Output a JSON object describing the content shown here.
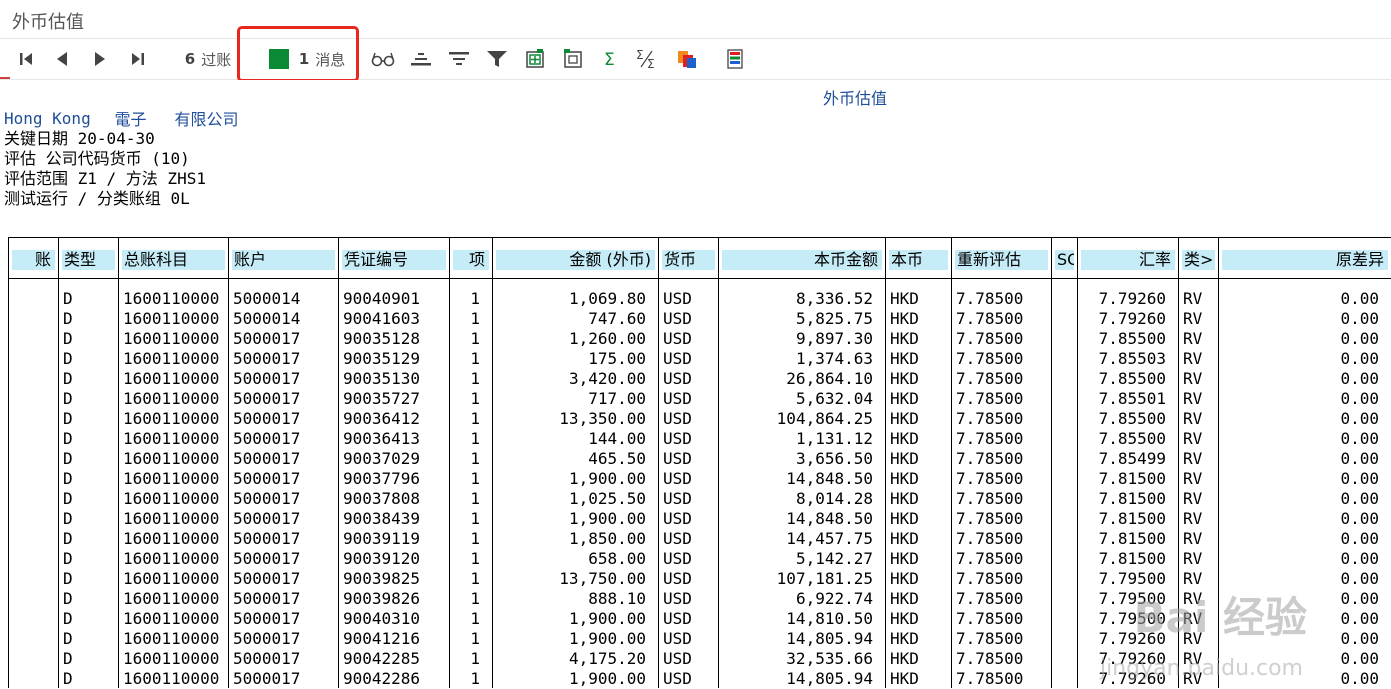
{
  "window": {
    "title": "外币估值"
  },
  "toolbar": {
    "post_count": "6",
    "post_label": "过账",
    "message_count": "1",
    "message_label": "消息",
    "accent_red": "#e8281e",
    "message_color": "#0b8a36",
    "icons": [
      "first-page-icon",
      "previous-page-icon",
      "next-page-icon",
      "last-page-icon",
      "glasses-icon",
      "sort-ascending-icon",
      "sort-descending-icon",
      "filter-icon",
      "export-icon",
      "import-icon",
      "sum-icon",
      "subtotal-icon",
      "layout-icon",
      "select-layout-icon"
    ]
  },
  "report": {
    "company_suffix_1": "電子",
    "company_suffix_2": "有限公司",
    "report_title": "外币估值",
    "location": "Hong Kong",
    "key_date_label": "关键日期",
    "key_date": "20-04-30",
    "line_valuation": "评估 公司代码货币 (10)",
    "line_area": "评估范围 Z1 / 方法 ZHS1",
    "line_test": "测试运行 / 分类账组 0L"
  },
  "table": {
    "columns": [
      "账",
      "类型",
      "总账科目",
      "账户",
      "凭证编号",
      "项",
      "金额 (外币)",
      "货币",
      "本币金额",
      "本币",
      "重新评估",
      "SG",
      "汇率",
      "类>",
      "原差异"
    ],
    "rows": [
      [
        "",
        "D",
        "1600110000",
        "5000014",
        "90040901",
        "1",
        "1,069.80",
        "USD",
        "8,336.52",
        "HKD",
        "7.78500",
        "",
        "7.79260",
        "RV",
        "0.00"
      ],
      [
        "",
        "D",
        "1600110000",
        "5000014",
        "90041603",
        "1",
        "747.60",
        "USD",
        "5,825.75",
        "HKD",
        "7.78500",
        "",
        "7.79260",
        "RV",
        "0.00"
      ],
      [
        "",
        "D",
        "1600110000",
        "5000017",
        "90035128",
        "1",
        "1,260.00",
        "USD",
        "9,897.30",
        "HKD",
        "7.78500",
        "",
        "7.85500",
        "RV",
        "0.00"
      ],
      [
        "",
        "D",
        "1600110000",
        "5000017",
        "90035129",
        "1",
        "175.00",
        "USD",
        "1,374.63",
        "HKD",
        "7.78500",
        "",
        "7.85503",
        "RV",
        "0.00"
      ],
      [
        "",
        "D",
        "1600110000",
        "5000017",
        "90035130",
        "1",
        "3,420.00",
        "USD",
        "26,864.10",
        "HKD",
        "7.78500",
        "",
        "7.85500",
        "RV",
        "0.00"
      ],
      [
        "",
        "D",
        "1600110000",
        "5000017",
        "90035727",
        "1",
        "717.00",
        "USD",
        "5,632.04",
        "HKD",
        "7.78500",
        "",
        "7.85501",
        "RV",
        "0.00"
      ],
      [
        "",
        "D",
        "1600110000",
        "5000017",
        "90036412",
        "1",
        "13,350.00",
        "USD",
        "104,864.25",
        "HKD",
        "7.78500",
        "",
        "7.85500",
        "RV",
        "0.00"
      ],
      [
        "",
        "D",
        "1600110000",
        "5000017",
        "90036413",
        "1",
        "144.00",
        "USD",
        "1,131.12",
        "HKD",
        "7.78500",
        "",
        "7.85500",
        "RV",
        "0.00"
      ],
      [
        "",
        "D",
        "1600110000",
        "5000017",
        "90037029",
        "1",
        "465.50",
        "USD",
        "3,656.50",
        "HKD",
        "7.78500",
        "",
        "7.85499",
        "RV",
        "0.00"
      ],
      [
        "",
        "D",
        "1600110000",
        "5000017",
        "90037796",
        "1",
        "1,900.00",
        "USD",
        "14,848.50",
        "HKD",
        "7.78500",
        "",
        "7.81500",
        "RV",
        "0.00"
      ],
      [
        "",
        "D",
        "1600110000",
        "5000017",
        "90037808",
        "1",
        "1,025.50",
        "USD",
        "8,014.28",
        "HKD",
        "7.78500",
        "",
        "7.81500",
        "RV",
        "0.00"
      ],
      [
        "",
        "D",
        "1600110000",
        "5000017",
        "90038439",
        "1",
        "1,900.00",
        "USD",
        "14,848.50",
        "HKD",
        "7.78500",
        "",
        "7.81500",
        "RV",
        "0.00"
      ],
      [
        "",
        "D",
        "1600110000",
        "5000017",
        "90039119",
        "1",
        "1,850.00",
        "USD",
        "14,457.75",
        "HKD",
        "7.78500",
        "",
        "7.81500",
        "RV",
        "0.00"
      ],
      [
        "",
        "D",
        "1600110000",
        "5000017",
        "90039120",
        "1",
        "658.00",
        "USD",
        "5,142.27",
        "HKD",
        "7.78500",
        "",
        "7.81500",
        "RV",
        "0.00"
      ],
      [
        "",
        "D",
        "1600110000",
        "5000017",
        "90039825",
        "1",
        "13,750.00",
        "USD",
        "107,181.25",
        "HKD",
        "7.78500",
        "",
        "7.79500",
        "RV",
        "0.00"
      ],
      [
        "",
        "D",
        "1600110000",
        "5000017",
        "90039826",
        "1",
        "888.10",
        "USD",
        "6,922.74",
        "HKD",
        "7.78500",
        "",
        "7.79500",
        "RV",
        "0.00"
      ],
      [
        "",
        "D",
        "1600110000",
        "5000017",
        "90040310",
        "1",
        "1,900.00",
        "USD",
        "14,810.50",
        "HKD",
        "7.78500",
        "",
        "7.79500",
        "RV",
        "0.00"
      ],
      [
        "",
        "D",
        "1600110000",
        "5000017",
        "90041216",
        "1",
        "1,900.00",
        "USD",
        "14,805.94",
        "HKD",
        "7.78500",
        "",
        "7.79260",
        "RV",
        "0.00"
      ],
      [
        "",
        "D",
        "1600110000",
        "5000017",
        "90042285",
        "1",
        "4,175.20",
        "USD",
        "32,535.66",
        "HKD",
        "7.78500",
        "",
        "7.79260",
        "RV",
        "0.00"
      ],
      [
        "",
        "D",
        "1600110000",
        "5000017",
        "90042286",
        "1",
        "1,900.00",
        "USD",
        "14,805.94",
        "HKD",
        "7.78500",
        "",
        "7.79260",
        "RV",
        "0.00"
      ]
    ]
  },
  "watermark": {
    "main": "Bai 经验",
    "sub": "jingyan.baidu.com"
  }
}
